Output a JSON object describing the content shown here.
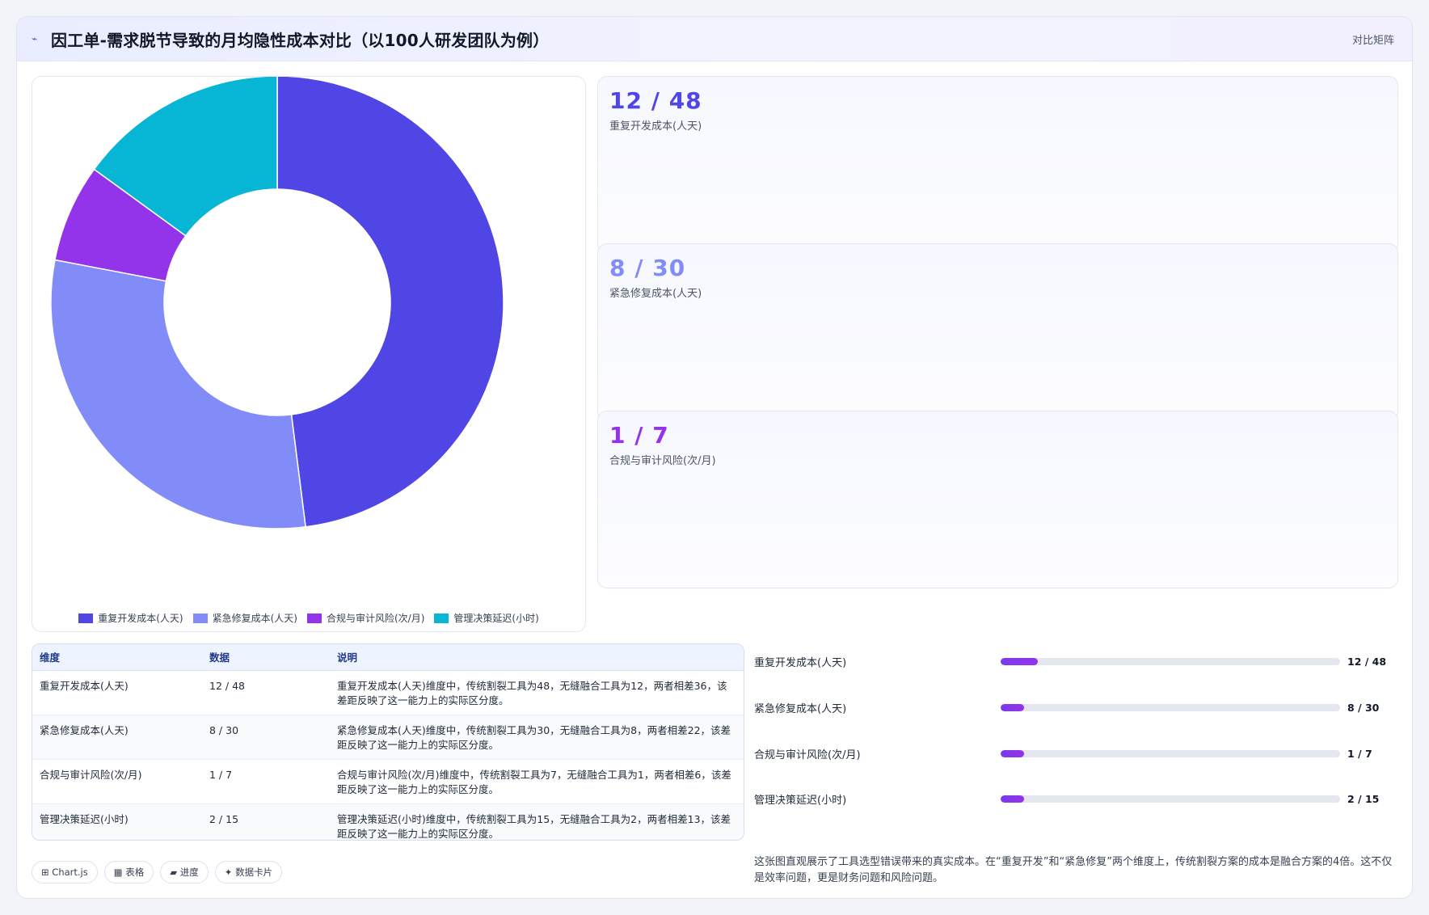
{
  "header": {
    "title": "因工单-需求脱节导致的月均隐性成本对比（以100人研发团队为例）",
    "matrix_label": "对比矩阵"
  },
  "chart_data": {
    "type": "pie",
    "categories": [
      "重复开发成本(人天)",
      "紧急修复成本(人天)",
      "合规与审计风险(次/月)",
      "管理决策延迟(小时)"
    ],
    "values": [
      48,
      30,
      7,
      15
    ],
    "colors": [
      "#4f46e5",
      "#818cf8",
      "#9333ea",
      "#06b6d4"
    ],
    "legend": "bottom"
  },
  "stats": [
    {
      "value": "12 / 48",
      "label": "重复开发成本(人天)",
      "color": "#4f46e5"
    },
    {
      "value": "8 / 30",
      "label": "紧急修复成本(人天)",
      "color": "#818cf8"
    },
    {
      "value": "1 / 7",
      "label": "合规与审计风险(次/月)",
      "color": "#9333ea"
    }
  ],
  "table": {
    "headers": [
      "维度",
      "数据",
      "说明"
    ],
    "rows": [
      {
        "dim": "重复开发成本(人天)",
        "data": "12 / 48",
        "desc": "重复开发成本(人天)维度中，传统割裂工具为48，无缝融合工具为12，两者相差36，该差距反映了这一能力上的实际区分度。"
      },
      {
        "dim": "紧急修复成本(人天)",
        "data": "8 / 30",
        "desc": "紧急修复成本(人天)维度中，传统割裂工具为30，无缝融合工具为8，两者相差22，该差距反映了这一能力上的实际区分度。"
      },
      {
        "dim": "合规与审计风险(次/月)",
        "data": "1 / 7",
        "desc": "合规与审计风险(次/月)维度中，传统割裂工具为7，无缝融合工具为1，两者相差6，该差距反映了这一能力上的实际区分度。"
      },
      {
        "dim": "管理决策延迟(小时)",
        "data": "2 / 15",
        "desc": "管理决策延迟(小时)维度中，传统割裂工具为15，无缝融合工具为2，两者相差13，该差距反映了这一能力上的实际区分度。"
      }
    ]
  },
  "progress": [
    {
      "label": "重复开发成本(人天)",
      "value": "12 / 48",
      "fraction": 0.11
    },
    {
      "label": "紧急修复成本(人天)",
      "value": "8 / 30",
      "fraction": 0.07
    },
    {
      "label": "合规与审计风险(次/月)",
      "value": "1 / 7",
      "fraction": 0.07
    },
    {
      "label": "管理决策延迟(小时)",
      "value": "2 / 15",
      "fraction": 0.07
    }
  ],
  "chips": [
    "⊞ Chart.js",
    "▦ 表格",
    "▰ 进度",
    "✦ 数据卡片"
  ],
  "summary": "这张图直观展示了工具选型错误带来的真实成本。在“重复开发”和“紧急修复”两个维度上，传统割裂方案的成本是融合方案的4倍。这不仅是效率问题，更是财务问题和风险问题。"
}
